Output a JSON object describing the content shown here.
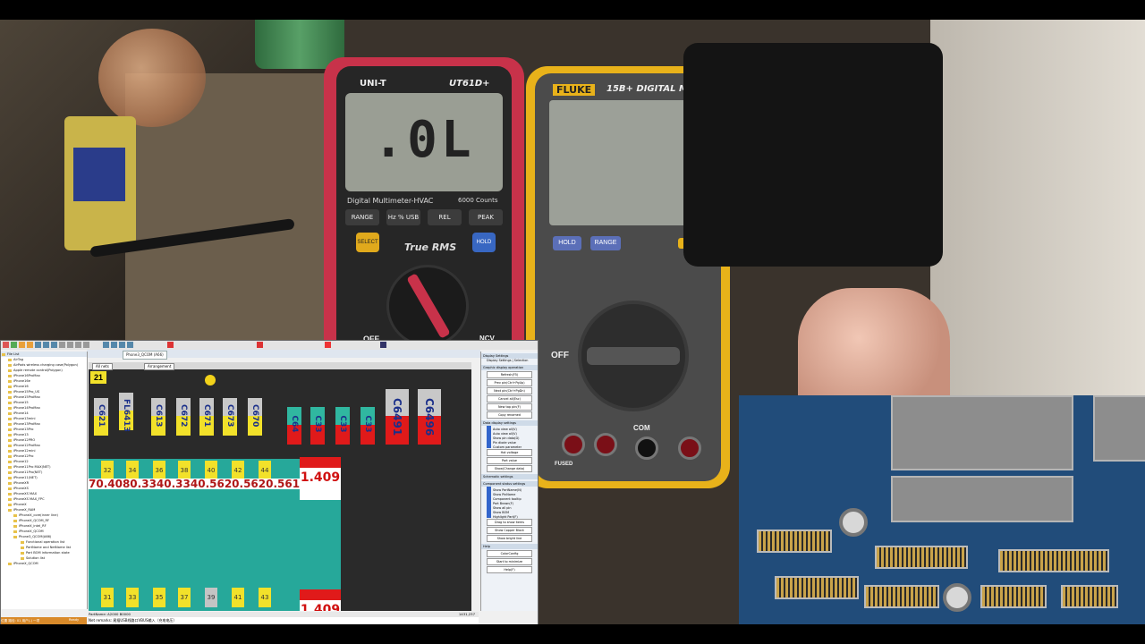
{
  "unit_meter": {
    "brand": "UNI-T",
    "model": "UT61D+",
    "reading": ".0L",
    "subtitle": "Digital Multimeter-HVAC",
    "counts": "6000 Counts",
    "buttons": [
      "RANGE",
      "Hz %",
      "REL",
      "PEAK"
    ],
    "usb": "USB",
    "true_rms": "True RMS",
    "select": "SELECT",
    "hold": "HOLD",
    "off": "OFF",
    "ncv": "NCV"
  },
  "fluke_meter": {
    "brand": "FLUKE",
    "model": "15B+ DIGITAL MULTIM",
    "hold": "HOLD",
    "range": "RANGE",
    "off": "OFF",
    "com": "COM",
    "fused": "FUSED"
  },
  "software": {
    "tabs": [
      "Phone3_QCOM (A66)"
    ],
    "canvas_tabs": [
      "All nets",
      "Arrangement"
    ],
    "tree": [
      "File List",
      "AirTag",
      "AirPods wireless charging case(Polygon)",
      "Apple remote control(Polygon)",
      "iPhone16ProMax",
      "iPhone16e",
      "iPhone16",
      "iPhone15Pro_US",
      "iPhone15ProMax",
      "iPhone15",
      "iPhone14ProMax",
      "iPhone14",
      "iPhone13mini",
      "iPhone13ProMax",
      "iPhone13Pro",
      "iPhone13",
      "iPhone12PRO",
      "iPhone12ProMax",
      "iPhone12mini",
      "iPhone12Pro",
      "iPhone12",
      "iPhone11Pro MAX(NET)",
      "iPhone11Pro(NET)",
      "iPhone11(NET)",
      "iPhoneXR",
      "iPhoneXS",
      "iPhoneXS MAX",
      "iPhoneXS MAX_FPC",
      "iPhoneX",
      "iPhoneX_RAM",
      "iPhoneX_core(inner line)",
      "iPhoneX_QCOM_RF",
      "iPhoneX_intel_RF",
      "iPhoneX_QCOM",
      "Phone3_QCOM(A66)",
      "Functional operation list",
      "PartName and NetName list",
      "Part BOM information state",
      "Solution list",
      "iPhoneX_QCOM"
    ],
    "components_top": [
      "C621",
      "FL6413",
      "C613",
      "C672",
      "C671",
      "C673",
      "C670"
    ],
    "components_red": [
      "C64",
      "C33",
      "C33",
      "C33"
    ],
    "components_big": [
      "C6491",
      "C6496"
    ],
    "label_21": "21",
    "pins_top": [
      "32",
      "34",
      "36",
      "38",
      "40",
      "42",
      "44"
    ],
    "values_row": "70.4080.3340.3340.5620.5620.5610.561",
    "redbox_value": "1.409",
    "redbox_value_2": "1.409",
    "pins_bottom": [
      "31",
      "33",
      "35",
      "37",
      "39",
      "41",
      "43"
    ],
    "side": {
      "header1": "Display Settings",
      "tabs": [
        "Display Settings",
        "Selection"
      ],
      "header2": "Graphic display operation",
      "buttons1": [
        "Refresh(F5)",
        "Prev pin(Ctrl+PgUp)",
        "Next pin(Ctrl+PgDn)",
        "Cancel all(Esc)",
        "New tap pin(F)",
        "Copy renamed"
      ],
      "header3": "Data display settings",
      "checks1": [
        "Auto view all(V)",
        "Auto view all(V)",
        "Show pin data(D)",
        "Pin diode value",
        "Custom parameter"
      ],
      "buttons2": [
        "Hot voltage",
        "Part value",
        "Show(Change data)"
      ],
      "header4": "Schematic settings",
      "header5": "Component status settings",
      "checks2": [
        "Show PartName(N)",
        "Show PinName",
        "Component tooltip",
        "Part Brown(F)",
        "Show all pin",
        "Show BOM",
        "Highlight Part(F)"
      ],
      "buttons3": [
        "Drag to show items",
        "Show Copper Block",
        "Show bright line"
      ],
      "header6": "Help",
      "buttons4": [
        "ColorConfig",
        "Start to minimize",
        "Help(F)"
      ]
    },
    "status": "PartName: A2000 B0000",
    "coords": "1431,237",
    "remarks": "Net remarks: 尾插USB线路口VBUS输入（充电电压）",
    "foot": "位置 路径: 01 用户(-) 一项",
    "ready": "Ready"
  }
}
